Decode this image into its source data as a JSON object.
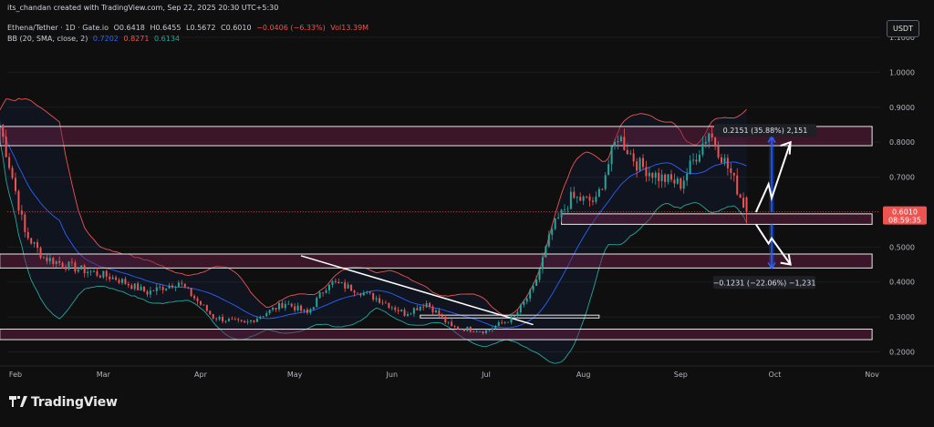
{
  "header": {
    "created_by": "its_chandan created with TradingView.com, Sep 22, 2025 20:30 UTC+5:30",
    "symbol": "Ethena/Tether · 1D · Gate.io",
    "open": "O0.6418",
    "high": "H0.6455",
    "low": "L0.5672",
    "close": "C0.6010",
    "change": "−0.0406 (−6.33%)",
    "volume": "Vol13.39M",
    "bb_label": "BB (20, SMA, close, 2)",
    "bb_basis": "0.7202",
    "bb_upper": "0.8271",
    "bb_lower": "0.6134"
  },
  "currency": "USDT",
  "price_badge": {
    "price": "0.6010",
    "countdown": "08:59:35"
  },
  "brand": "TradingView",
  "annotations": {
    "upside": "0.2151 (35.88%) 2,151",
    "downside": "−0.1231 (−22.06%) −1,231"
  },
  "colors": {
    "background": "#0f0f0f",
    "bullish": "#26a69a",
    "bearish": "#ef5350",
    "bb_basis": "#2962ff",
    "bb_upper": "#ef5350",
    "bb_lower": "#26a69a",
    "zone_fill": "#3d1a2c",
    "projection": "#2962ff"
  },
  "chart_data": {
    "type": "candlestick",
    "title": "",
    "ylabel": "",
    "ylim": [
      0.17,
      1.16
    ],
    "y_ticks": [
      "1.1000",
      "1.0000",
      "0.9000",
      "0.8000",
      "0.7000",
      "0.6000",
      "0.5000",
      "0.4000",
      "0.3000",
      "0.2000"
    ],
    "x_ticks": [
      "Feb",
      "Mar",
      "Apr",
      "May",
      "Jun",
      "Jul",
      "Aug",
      "Sep",
      "Oct",
      "Nov"
    ],
    "start": "2025-01-27",
    "close_path": [
      {
        "date": "2025-01-27",
        "close": 0.85
      },
      {
        "date": "2025-01-31",
        "close": 0.7
      },
      {
        "date": "2025-02-04",
        "close": 0.54
      },
      {
        "date": "2025-02-10",
        "close": 0.47
      },
      {
        "date": "2025-02-20",
        "close": 0.44
      },
      {
        "date": "2025-03-05",
        "close": 0.41
      },
      {
        "date": "2025-03-15",
        "close": 0.37
      },
      {
        "date": "2025-03-25",
        "close": 0.4
      },
      {
        "date": "2025-04-05",
        "close": 0.3
      },
      {
        "date": "2025-04-15",
        "close": 0.28
      },
      {
        "date": "2025-04-28",
        "close": 0.34
      },
      {
        "date": "2025-05-05",
        "close": 0.31
      },
      {
        "date": "2025-05-12",
        "close": 0.4
      },
      {
        "date": "2025-05-20",
        "close": 0.38
      },
      {
        "date": "2025-05-28",
        "close": 0.35
      },
      {
        "date": "2025-06-05",
        "close": 0.31
      },
      {
        "date": "2025-06-12",
        "close": 0.34
      },
      {
        "date": "2025-06-20",
        "close": 0.27
      },
      {
        "date": "2025-07-01",
        "close": 0.26
      },
      {
        "date": "2025-07-10",
        "close": 0.3
      },
      {
        "date": "2025-07-16",
        "close": 0.38
      },
      {
        "date": "2025-07-22",
        "close": 0.55
      },
      {
        "date": "2025-07-28",
        "close": 0.64
      },
      {
        "date": "2025-08-05",
        "close": 0.63
      },
      {
        "date": "2025-08-12",
        "close": 0.82
      },
      {
        "date": "2025-08-18",
        "close": 0.74
      },
      {
        "date": "2025-08-25",
        "close": 0.7
      },
      {
        "date": "2025-09-01",
        "close": 0.68
      },
      {
        "date": "2025-09-10",
        "close": 0.83
      },
      {
        "date": "2025-09-17",
        "close": 0.71
      },
      {
        "date": "2025-09-22",
        "close": 0.601
      }
    ],
    "last_candle": {
      "date": "2025-09-22",
      "open": 0.6418,
      "high": 0.6455,
      "low": 0.5672,
      "close": 0.601
    },
    "bollinger": {
      "period": 20,
      "basis": 0.7202,
      "upper": 0.8271,
      "lower": 0.6134
    },
    "zones": [
      {
        "from": "2025-01-27",
        "to": "2025-11-01",
        "low": 0.79,
        "high": 0.845
      },
      {
        "from": "2025-07-25",
        "to": "2025-11-01",
        "low": 0.565,
        "high": 0.595
      },
      {
        "from": "2025-01-27",
        "to": "2025-11-01",
        "low": 0.44,
        "high": 0.48
      },
      {
        "from": "2025-06-10",
        "to": "2025-08-06",
        "low": 0.297,
        "high": 0.305
      },
      {
        "from": "2025-01-27",
        "to": "2025-11-01",
        "low": 0.235,
        "high": 0.265
      }
    ],
    "trendline": [
      {
        "date": "2025-05-03",
        "price": 0.475
      },
      {
        "date": "2025-07-16",
        "price": 0.278
      }
    ],
    "measure_up": {
      "from": 0.6,
      "to": 0.815,
      "change": 0.2151,
      "pct": 35.88
    },
    "measure_down": {
      "from": 0.565,
      "to": 0.44,
      "change": -0.1231,
      "pct": -22.06
    }
  }
}
